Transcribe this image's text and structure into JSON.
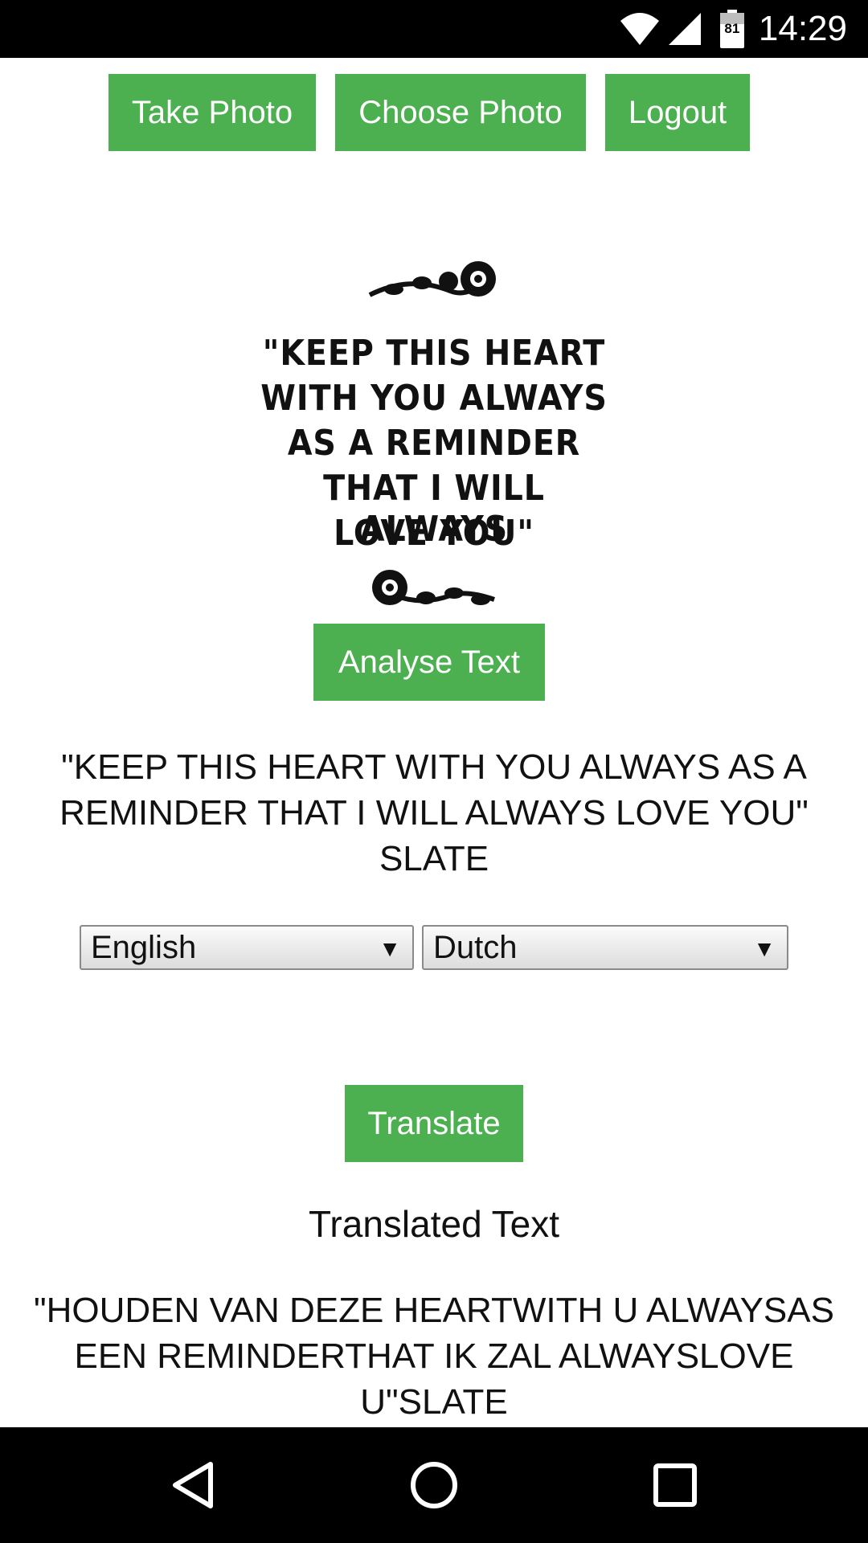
{
  "status_bar": {
    "time": "14:29",
    "battery_level": "81",
    "icons": [
      "wifi-icon",
      "cell-signal-icon",
      "battery-icon"
    ]
  },
  "toolbar": {
    "take_photo": "Take Photo",
    "choose_photo": "Choose Photo",
    "logout": "Logout"
  },
  "photo": {
    "lines": [
      "\"KEEP THIS HEART",
      "WITH YOU ALWAYS",
      "AS A REMINDER",
      "THAT I WILL ALWAYS",
      "LOVE YOU\""
    ]
  },
  "analyse": {
    "button": "Analyse Text",
    "result": "\"KEEP THIS HEART WITH YOU ALWAYS AS A REMINDER THAT I WILL ALWAYS LOVE YOU\" SLATE"
  },
  "languages": {
    "from": "English",
    "to": "Dutch"
  },
  "translate": {
    "button": "Translate",
    "heading": "Translated Text",
    "result": "\"HOUDEN VAN DEZE HEARTWITH U ALWAYSAS EEN REMINDERTHAT IK ZAL ALWAYSLOVE U\"SLATE"
  },
  "nav_bar": {
    "icons": [
      "back-icon",
      "home-icon",
      "recents-icon"
    ]
  },
  "colors": {
    "accent": "#4cb050",
    "status_bar": "#000000",
    "nav_bar": "#000000"
  }
}
